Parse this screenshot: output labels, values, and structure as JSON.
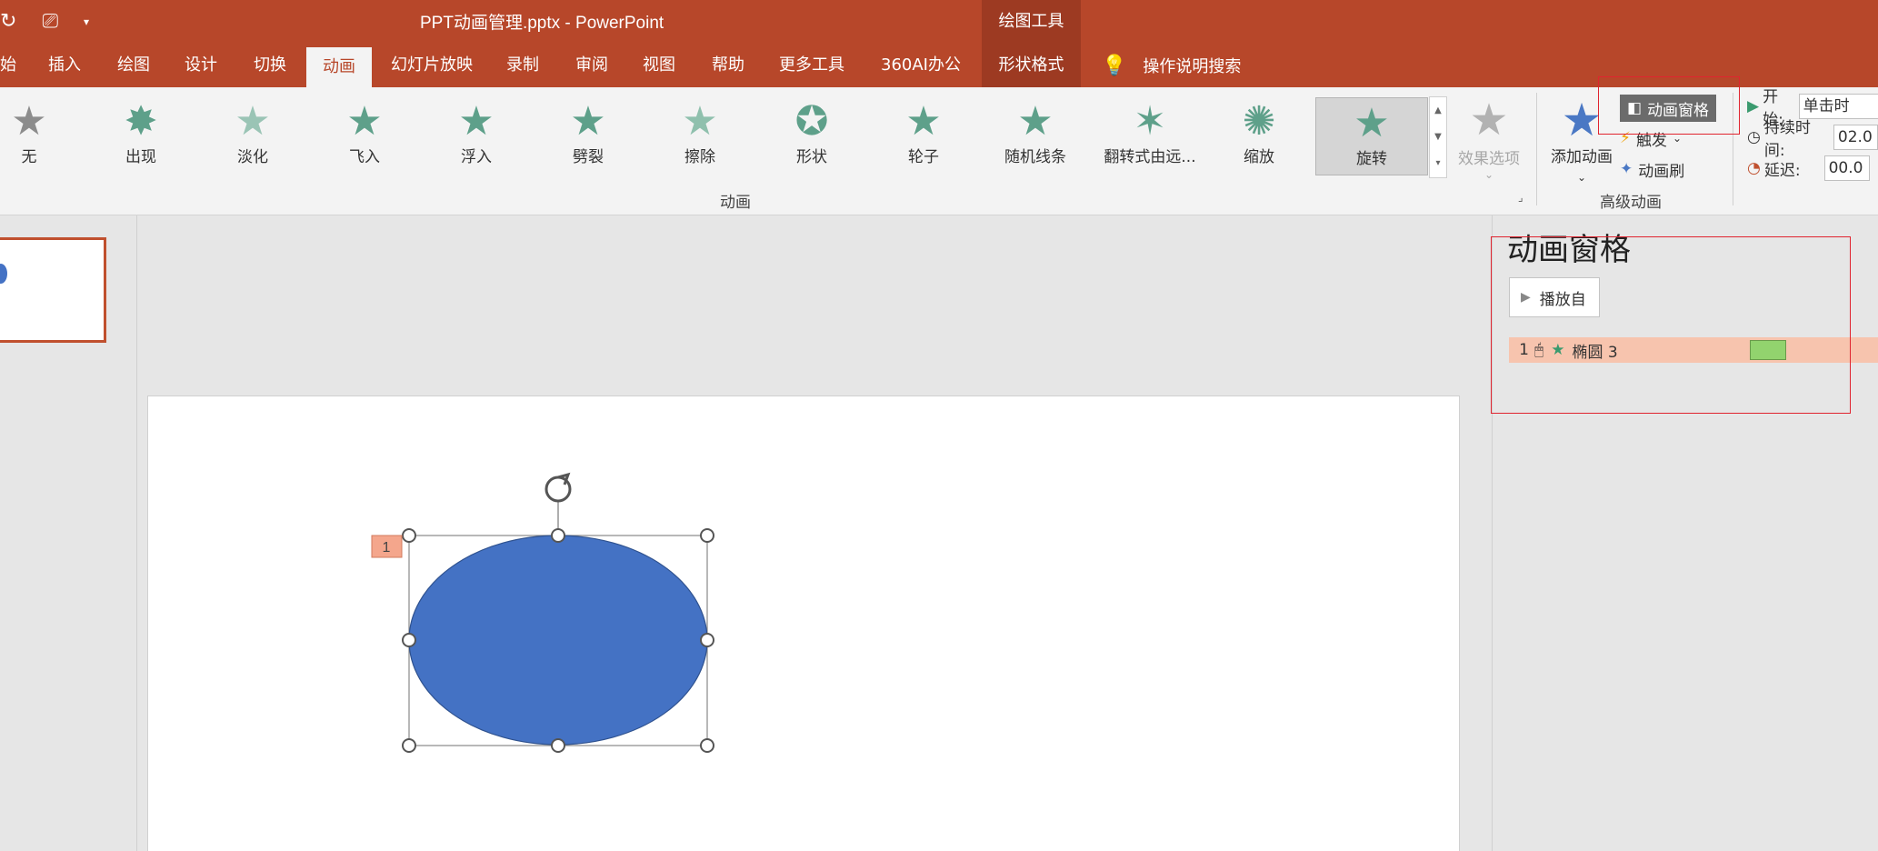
{
  "titlebar": {
    "title": "PPT动画管理.pptx  -  PowerPoint",
    "context_group": "绘图工具",
    "qat_icons": [
      "redo-icon",
      "present-icon",
      "customize-icon"
    ]
  },
  "tabs": [
    {
      "label": "始"
    },
    {
      "label": "插入"
    },
    {
      "label": "绘图"
    },
    {
      "label": "设计"
    },
    {
      "label": "切换"
    },
    {
      "label": "动画",
      "active": true
    },
    {
      "label": "幻灯片放映"
    },
    {
      "label": "录制"
    },
    {
      "label": "审阅"
    },
    {
      "label": "视图"
    },
    {
      "label": "帮助"
    },
    {
      "label": "更多工具"
    },
    {
      "label": "360AI办公"
    },
    {
      "label": "形状格式",
      "context": true
    }
  ],
  "search": {
    "label": "操作说明搜索"
  },
  "gallery": {
    "items": [
      {
        "label": "无"
      },
      {
        "label": "出现"
      },
      {
        "label": "淡化"
      },
      {
        "label": "飞入"
      },
      {
        "label": "浮入"
      },
      {
        "label": "劈裂"
      },
      {
        "label": "擦除"
      },
      {
        "label": "形状"
      },
      {
        "label": "轮子"
      },
      {
        "label": "随机线条"
      },
      {
        "label": "翻转式由远..."
      },
      {
        "label": "缩放"
      },
      {
        "label": "旋转",
        "selected": true
      }
    ],
    "effect_options": "效果选项",
    "group_label": "动画"
  },
  "advanced": {
    "add_animation": "添加动画",
    "animation_pane": "动画窗格",
    "trigger": "触发",
    "painter": "动画刷",
    "group_label": "高级动画"
  },
  "timing": {
    "start_label": "开始:",
    "start_value": "单击时",
    "duration_label": "持续时间:",
    "duration_value": "02.0",
    "delay_label": "延迟:",
    "delay_value": "00.0"
  },
  "slide": {
    "anim_tag": "1"
  },
  "pane": {
    "title": "动画窗格",
    "play_from": "播放自",
    "items": [
      {
        "index": "1",
        "name": "椭圆 3"
      }
    ]
  },
  "colors": {
    "accent": "#b7472a",
    "shape_fill": "#4472c4",
    "anim_row": "#f7c4ae",
    "timeline_bar": "#92d36e"
  }
}
